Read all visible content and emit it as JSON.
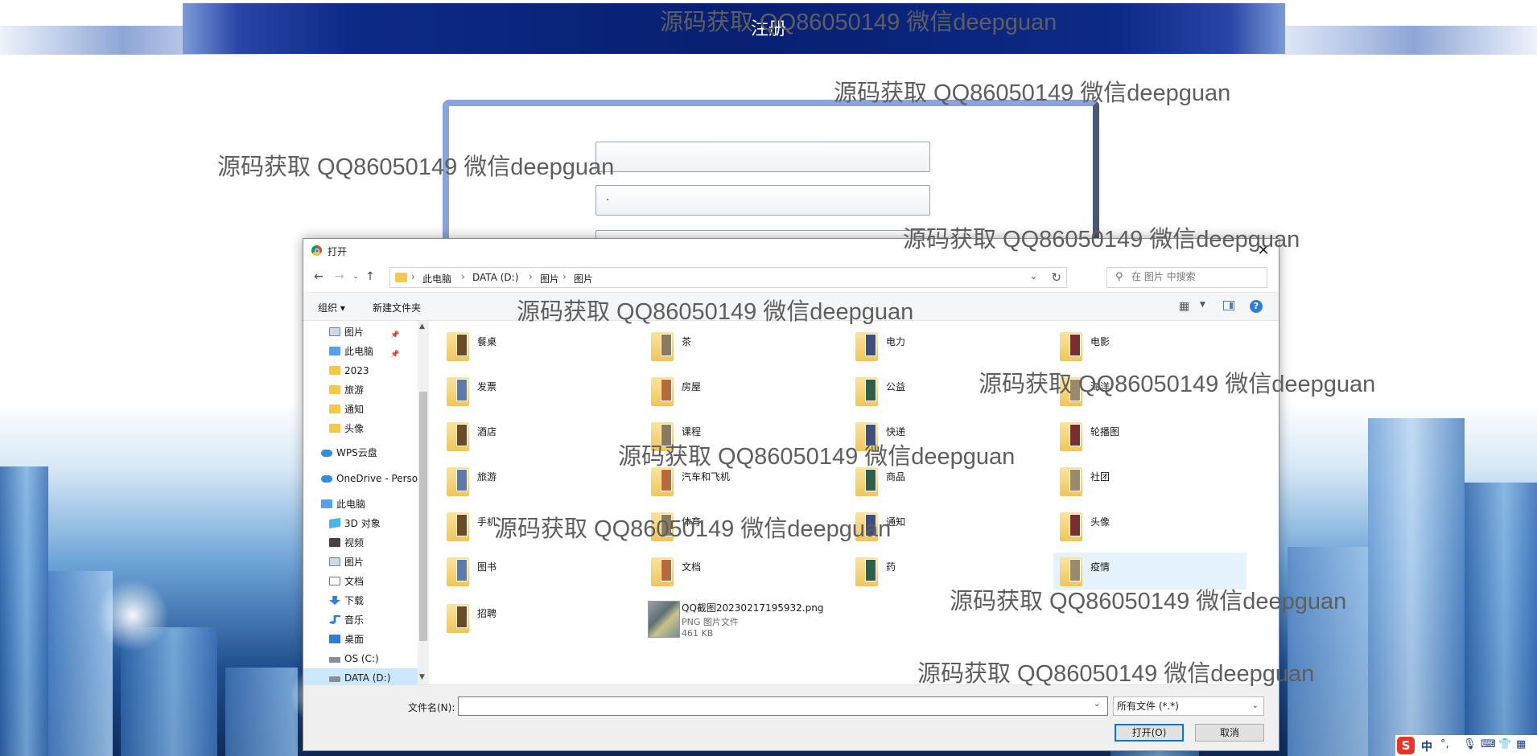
{
  "page": {
    "header_title": "注册",
    "reg_fields": [
      "",
      "·",
      ""
    ]
  },
  "watermark_text": "源码获取 QQ86050149 微信deepguan",
  "dialog": {
    "title": "打开",
    "close_glyph": "✕",
    "breadcrumb": [
      "此电脑",
      "DATA (D:)",
      "图片",
      "图片"
    ],
    "search_placeholder": "在 图片 中搜索",
    "toolbar": {
      "organize": "组织 ▾",
      "new_folder": "新建文件夹",
      "help": "?"
    },
    "sidebar": [
      {
        "label": "图片",
        "icon": "picture-icon",
        "pinned": true
      },
      {
        "label": "此电脑",
        "icon": "pc-icon",
        "pinned": true
      },
      {
        "label": "2023",
        "icon": "folder-icon"
      },
      {
        "label": "旅游",
        "icon": "folder-icon"
      },
      {
        "label": "通知",
        "icon": "folder-icon"
      },
      {
        "label": "头像",
        "icon": "folder-icon"
      },
      {
        "label": "WPS云盘",
        "icon": "cloud-icon"
      },
      {
        "label": "OneDrive - Perso",
        "icon": "onedrive-icon"
      },
      {
        "label": "此电脑",
        "icon": "pc-icon"
      },
      {
        "label": "3D 对象",
        "icon": "3d-objects-icon"
      },
      {
        "label": "视频",
        "icon": "video-icon"
      },
      {
        "label": "图片",
        "icon": "picture-icon"
      },
      {
        "label": "文档",
        "icon": "document-icon"
      },
      {
        "label": "下载",
        "icon": "download-icon"
      },
      {
        "label": "音乐",
        "icon": "music-icon"
      },
      {
        "label": "桌面",
        "icon": "desktop-icon"
      },
      {
        "label": "OS (C:)",
        "icon": "drive-icon"
      },
      {
        "label": "DATA (D:)",
        "icon": "drive-icon"
      }
    ],
    "folders": [
      "餐桌",
      "茶",
      "电力",
      "电影",
      "发票",
      "房屋",
      "公益",
      "海洋",
      "酒店",
      "课程",
      "快递",
      "轮播图",
      "旅游",
      "汽车和飞机",
      "商品",
      "社团",
      "手机",
      "体育",
      "通知",
      "头像",
      "图书",
      "文档",
      "药",
      "疫情",
      "招聘"
    ],
    "file": {
      "name": "QQ截图20230217195932.png",
      "type": "PNG 图片文件",
      "size": "461 KB"
    },
    "filename_label": "文件名(N):",
    "filename_value": "",
    "filetype_selected": "所有文件 (*.*)",
    "open_label": "打开(O)",
    "cancel_label": "取消"
  },
  "ime": {
    "s": "S",
    "lang": "中"
  }
}
